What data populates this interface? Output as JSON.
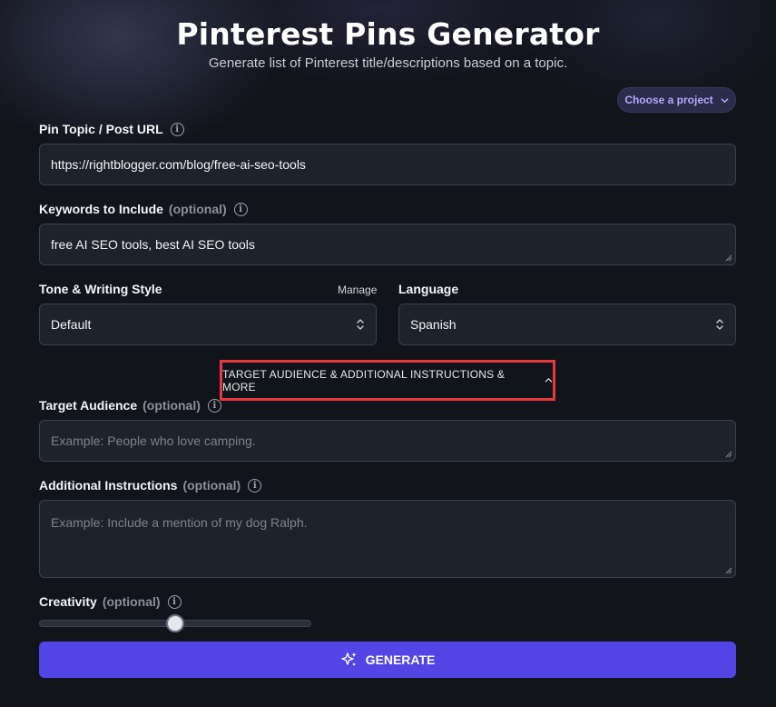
{
  "header": {
    "title": "Pinterest Pins Generator",
    "subtitle": "Generate list of Pinterest title/descriptions based on a topic."
  },
  "project_selector": {
    "label": "Choose a project",
    "icon": "chevron-down-icon"
  },
  "fields": {
    "topic": {
      "label": "Pin Topic / Post URL",
      "value": "https://rightblogger.com/blog/free-ai-seo-tools"
    },
    "keywords": {
      "label": "Keywords to Include",
      "optional": "(optional)",
      "value": "free AI SEO tools, best AI SEO tools"
    },
    "tone": {
      "label": "Tone & Writing Style",
      "manage": "Manage",
      "value": "Default"
    },
    "language": {
      "label": "Language",
      "value": "Spanish"
    },
    "audience": {
      "label": "Target Audience",
      "optional": "(optional)",
      "placeholder": "Example: People who love camping."
    },
    "instructions": {
      "label": "Additional Instructions",
      "optional": "(optional)",
      "placeholder": "Example: Include a mention of my dog Ralph."
    },
    "creativity": {
      "label": "Creativity",
      "optional": "(optional)",
      "value": 0.5
    }
  },
  "toggle": {
    "label": "TARGET AUDIENCE & ADDITIONAL INSTRUCTIONS & MORE",
    "icon": "chevron-up-icon"
  },
  "generate": {
    "label": "GENERATE",
    "icon": "sparkles-icon"
  },
  "colors": {
    "accent": "#5146e5",
    "highlight_border": "#e5393c",
    "project_text": "#b9a8ff"
  }
}
